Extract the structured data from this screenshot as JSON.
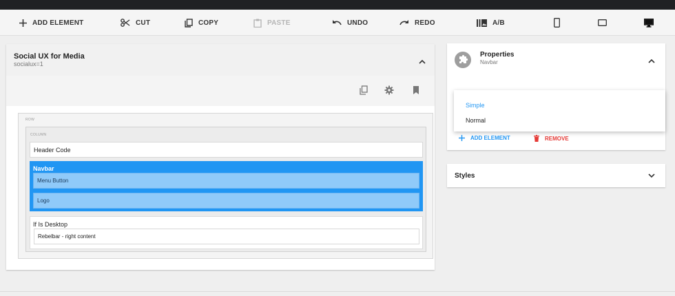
{
  "toolbar": {
    "add_element": "ADD ELEMENT",
    "cut": "CUT",
    "copy": "COPY",
    "paste": "PASTE",
    "undo": "UNDO",
    "redo": "REDO",
    "ab": "A/B",
    "device_icons": [
      "mobile-icon",
      "tablet-icon",
      "desktop-icon"
    ]
  },
  "page": {
    "title": "Social UX for Media",
    "subtitle": "socialux=1",
    "actions": [
      "copy-icon",
      "gear-icon",
      "bookmark-icon"
    ]
  },
  "tree": {
    "row_label": "ROW",
    "column_label": "COLUMN",
    "header_code": "Header Code",
    "navbar": {
      "label": "Navbar",
      "children": [
        "Menu Button",
        "Logo"
      ]
    },
    "if_desktop": {
      "label": "If Is Desktop",
      "child": "Rebelbar - right content"
    }
  },
  "properties": {
    "title": "Properties",
    "subtitle": "Navbar",
    "dropdown_options": [
      "Simple",
      "Normal"
    ],
    "selected_option": "Simple",
    "add_element": "ADD ELEMENT",
    "remove": "REMOVE"
  },
  "styles": {
    "title": "Styles"
  },
  "colors": {
    "accent": "#2196f3",
    "selected_child": "#90caf9",
    "remove": "#e53935",
    "topbar": "#202124"
  }
}
